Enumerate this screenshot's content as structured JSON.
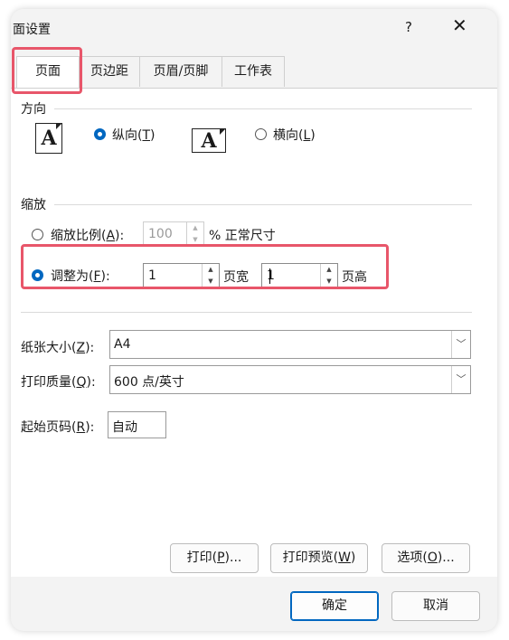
{
  "window": {
    "title": "面设置",
    "help": "?",
    "close": "✕"
  },
  "tabs": [
    {
      "label": "页面",
      "active": true
    },
    {
      "label": "页边距",
      "active": false
    },
    {
      "label": "页眉/页脚",
      "active": false
    },
    {
      "label": "工作表",
      "active": false
    }
  ],
  "orientation": {
    "section": "方向",
    "portrait_label": "纵向(",
    "portrait_key": "T",
    "portrait_end": ")",
    "landscape_label": "横向(",
    "landscape_key": "L",
    "landscape_end": ")",
    "icon_letter": "A",
    "selected": "portrait"
  },
  "scaling": {
    "section": "缩放",
    "adjust_label": "缩放比例(",
    "adjust_key": "A",
    "adjust_end": "):",
    "adjust_value": "100",
    "adjust_suffix": "% 正常尺寸",
    "fit_label": "调整为(",
    "fit_key": "F",
    "fit_end": "):",
    "fit_wide_value": "1",
    "fit_wide_suffix": "页宽",
    "fit_tall_value": "1",
    "fit_tall_suffix": "页高",
    "selected": "fit"
  },
  "paper_size": {
    "label": "纸张大小(",
    "key": "Z",
    "end": "):",
    "value": "A4"
  },
  "print_quality": {
    "label": "打印质量(",
    "key": "Q",
    "end": "):",
    "value": "600 点/英寸"
  },
  "first_page": {
    "label": "起始页码(",
    "key": "R",
    "end": "):",
    "value": "自动"
  },
  "buttons": {
    "print": {
      "label": "打印(",
      "key": "P",
      "end": ")..."
    },
    "preview": {
      "label": "打印预览(",
      "key": "W",
      "end": ")"
    },
    "options": {
      "label": "选项(",
      "key": "O",
      "end": ")..."
    },
    "ok": "确定",
    "cancel": "取消"
  },
  "colors": {
    "accent": "#0067c0",
    "highlight": "#e8566a"
  }
}
